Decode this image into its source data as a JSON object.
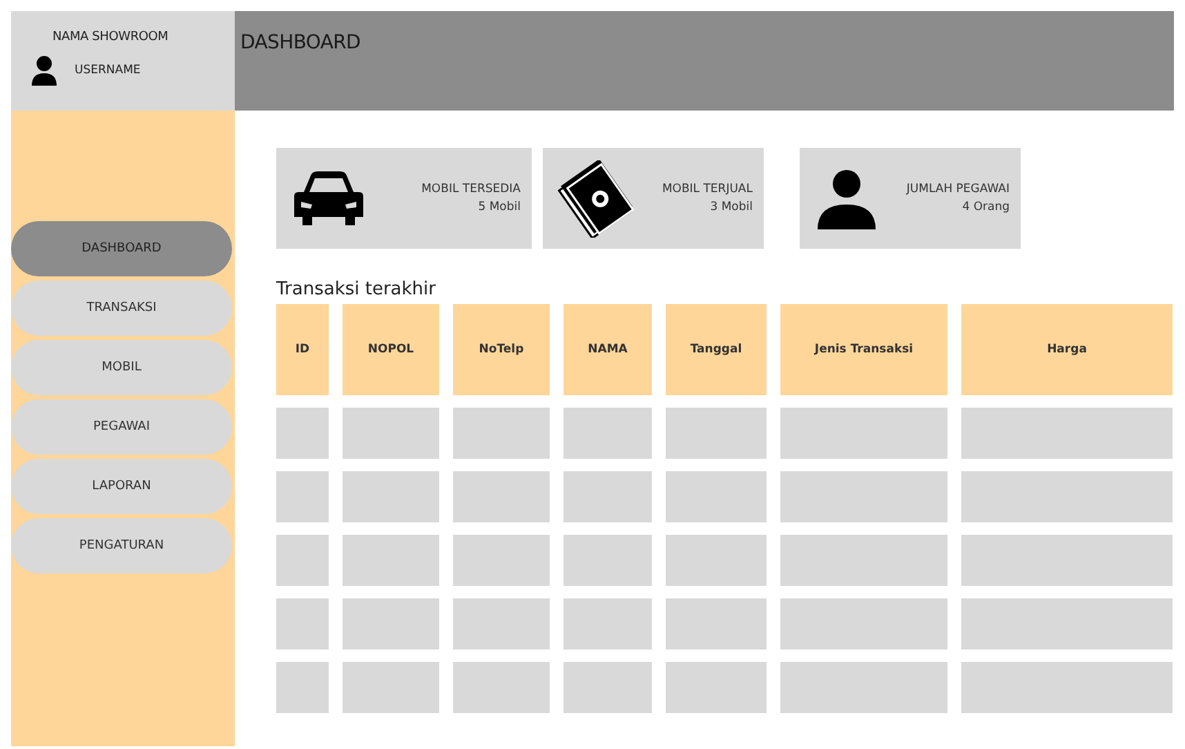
{
  "sidebar": {
    "showroom_name": "NAMA SHOWROOM",
    "username": "USERNAME",
    "items": [
      {
        "label": "DASHBOARD",
        "selected": true
      },
      {
        "label": "TRANSAKSI",
        "selected": false
      },
      {
        "label": "MOBIL",
        "selected": false
      },
      {
        "label": "PEGAWAI",
        "selected": false
      },
      {
        "label": "LAPORAN",
        "selected": false
      },
      {
        "label": "PENGATURAN",
        "selected": false
      }
    ]
  },
  "header": {
    "title": "DASHBOARD"
  },
  "stats": [
    {
      "kind": "car",
      "label": "MOBIL TERSEDIA",
      "value": "5 Mobil"
    },
    {
      "kind": "money",
      "label": "MOBIL TERJUAL",
      "value": "3 Mobil"
    },
    {
      "kind": "person",
      "label": "JUMLAH PEGAWAI",
      "value": "4 Orang"
    }
  ],
  "table": {
    "title": "Transaksi terakhir",
    "columns": [
      "ID",
      "NOPOL",
      "NoTelp",
      "NAMA",
      "Tanggal",
      "Jenis Transaksi",
      "Harga"
    ],
    "rows": [
      {
        "kind": "blank"
      },
      {
        "kind": "blank"
      },
      {
        "kind": "blank"
      },
      {
        "kind": "blank"
      },
      {
        "kind": "blank"
      }
    ]
  }
}
